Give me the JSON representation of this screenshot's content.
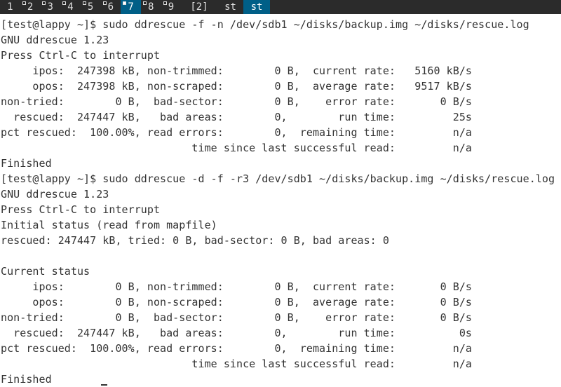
{
  "bar": {
    "tags": [
      {
        "label": "1",
        "occupied": false,
        "active": false
      },
      {
        "label": "2",
        "occupied": true,
        "active": false
      },
      {
        "label": "3",
        "occupied": true,
        "active": false
      },
      {
        "label": "4",
        "occupied": true,
        "active": false
      },
      {
        "label": "5",
        "occupied": true,
        "active": false
      },
      {
        "label": "6",
        "occupied": true,
        "active": false
      },
      {
        "label": "7",
        "occupied": true,
        "active": true
      },
      {
        "label": "8",
        "occupied": true,
        "active": false
      },
      {
        "label": "9",
        "occupied": true,
        "active": false
      }
    ],
    "layout": "[2]",
    "windows": [
      {
        "label": "st",
        "active": false
      },
      {
        "label": "st",
        "active": true
      }
    ],
    "accent": "#005f87"
  },
  "terminal": {
    "lines": [
      "[test@lappy ~]$ sudo ddrescue -f -n /dev/sdb1 ~/disks/backup.img ~/disks/rescue.log",
      "GNU ddrescue 1.23",
      "Press Ctrl-C to interrupt",
      "     ipos:  247398 kB, non-trimmed:        0 B,  current rate:   5160 kB/s",
      "     opos:  247398 kB, non-scraped:        0 B,  average rate:   9517 kB/s",
      "non-tried:        0 B,  bad-sector:        0 B,    error rate:       0 B/s",
      "  rescued:  247447 kB,   bad areas:        0,        run time:         25s",
      "pct rescued:  100.00%, read errors:        0,  remaining time:         n/a",
      "                              time since last successful read:         n/a",
      "Finished",
      "[test@lappy ~]$ sudo ddrescue -d -f -r3 /dev/sdb1 ~/disks/backup.img ~/disks/rescue.log",
      "GNU ddrescue 1.23",
      "Press Ctrl-C to interrupt",
      "Initial status (read from mapfile)",
      "rescued: 247447 kB, tried: 0 B, bad-sector: 0 B, bad areas: 0",
      "",
      "Current status",
      "     ipos:        0 B, non-trimmed:        0 B,  current rate:       0 B/s",
      "     opos:        0 B, non-scraped:        0 B,  average rate:       0 B/s",
      "non-tried:        0 B,  bad-sector:        0 B,    error rate:       0 B/s",
      "  rescued:  247447 kB,   bad areas:        0,        run time:          0s",
      "pct rescued:  100.00%, read errors:        0,  remaining time:         n/a",
      "                              time since last successful read:         n/a",
      "Finished"
    ]
  }
}
